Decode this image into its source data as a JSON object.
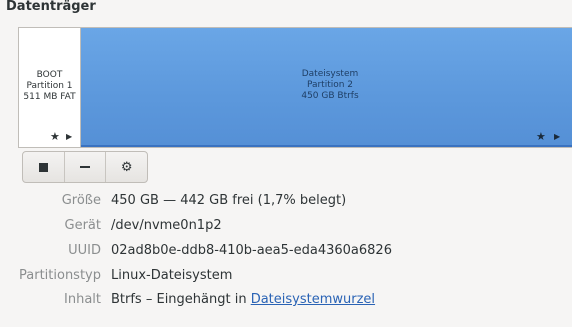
{
  "section_title": "Datenträger",
  "partitions": [
    {
      "name": "BOOT",
      "partition": "Partition 1",
      "size": "511 MB FAT",
      "selected": false
    },
    {
      "name": "Dateisystem",
      "partition": "Partition 2",
      "size": "450 GB Btrfs",
      "selected": true
    }
  ],
  "icons": {
    "star": "★",
    "play": "▶",
    "gear": "⚙"
  },
  "toolbar": {
    "buttons": [
      "stop",
      "remove",
      "settings"
    ]
  },
  "properties": [
    {
      "label": "Größe",
      "value": "450 GB — 442 GB frei (1,7% belegt)"
    },
    {
      "label": "Gerät",
      "value": "/dev/nvme0n1p2"
    },
    {
      "label": "UUID",
      "value": "02ad8b0e-ddb8-410b-aea5-eda4360a6826"
    },
    {
      "label": "Partitionstyp",
      "value": "Linux-Dateisystem"
    },
    {
      "label": "Inhalt",
      "value_prefix": "Btrfs – Eingehängt in ",
      "value_link": "Dateisystemwurzel"
    }
  ],
  "colors": {
    "partition_selected": "#5c98dc",
    "label": "#8b8e8f",
    "link": "#2a63b5"
  }
}
